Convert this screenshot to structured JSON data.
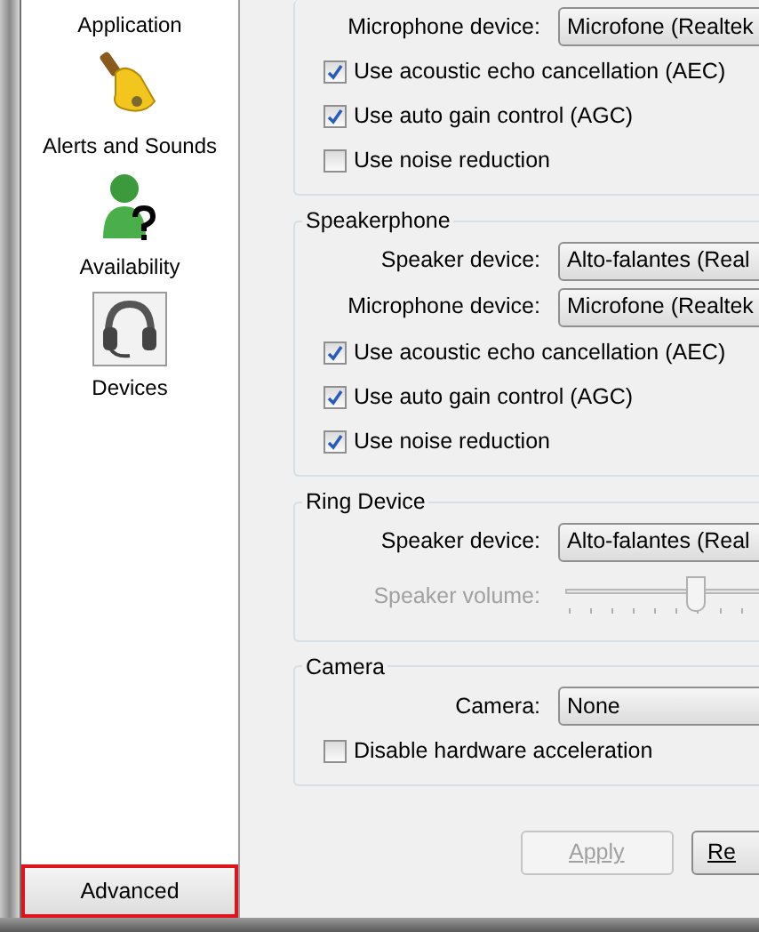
{
  "sidebar": {
    "items": [
      {
        "label": "Application",
        "selected": false
      },
      {
        "label": "Alerts and Sounds",
        "selected": false
      },
      {
        "label": "Availability",
        "selected": false
      },
      {
        "label": "Devices",
        "selected": true
      }
    ]
  },
  "advanced_button": {
    "label": "Advanced",
    "highlighted": true
  },
  "groups": [
    {
      "rows": [
        {
          "kind": "dropdown",
          "label": "Microphone device:",
          "value": "Microfone (Realtek"
        },
        {
          "kind": "checkbox",
          "label": "Use acoustic echo cancellation (AEC)",
          "checked": true
        },
        {
          "kind": "checkbox",
          "label": "Use auto gain control (AGC)",
          "checked": true
        },
        {
          "kind": "checkbox",
          "label": "Use noise reduction",
          "checked": false
        }
      ]
    },
    {
      "title": "Speakerphone",
      "rows": [
        {
          "kind": "dropdown",
          "label": "Speaker device:",
          "value": "Alto-falantes (Real"
        },
        {
          "kind": "dropdown",
          "label": "Microphone device:",
          "value": "Microfone (Realtek"
        },
        {
          "kind": "checkbox",
          "label": "Use acoustic echo cancellation (AEC)",
          "checked": true
        },
        {
          "kind": "checkbox",
          "label": "Use auto gain control (AGC)",
          "checked": true
        },
        {
          "kind": "checkbox",
          "label": "Use noise reduction",
          "checked": true
        }
      ]
    },
    {
      "title": "Ring Device",
      "rows": [
        {
          "kind": "dropdown",
          "label": "Speaker device:",
          "value": "Alto-falantes (Real"
        },
        {
          "kind": "slider",
          "label": "Speaker volume:",
          "level": 0.55,
          "disabled": true
        }
      ]
    },
    {
      "title": "Camera",
      "rows": [
        {
          "kind": "dropdown",
          "label": "Camera:",
          "value": "None"
        },
        {
          "kind": "checkbox",
          "label": "Disable hardware acceleration",
          "checked": false
        }
      ]
    }
  ],
  "buttons": [
    {
      "label": "Apply",
      "disabled": true
    },
    {
      "label": "Re",
      "disabled": false
    }
  ]
}
